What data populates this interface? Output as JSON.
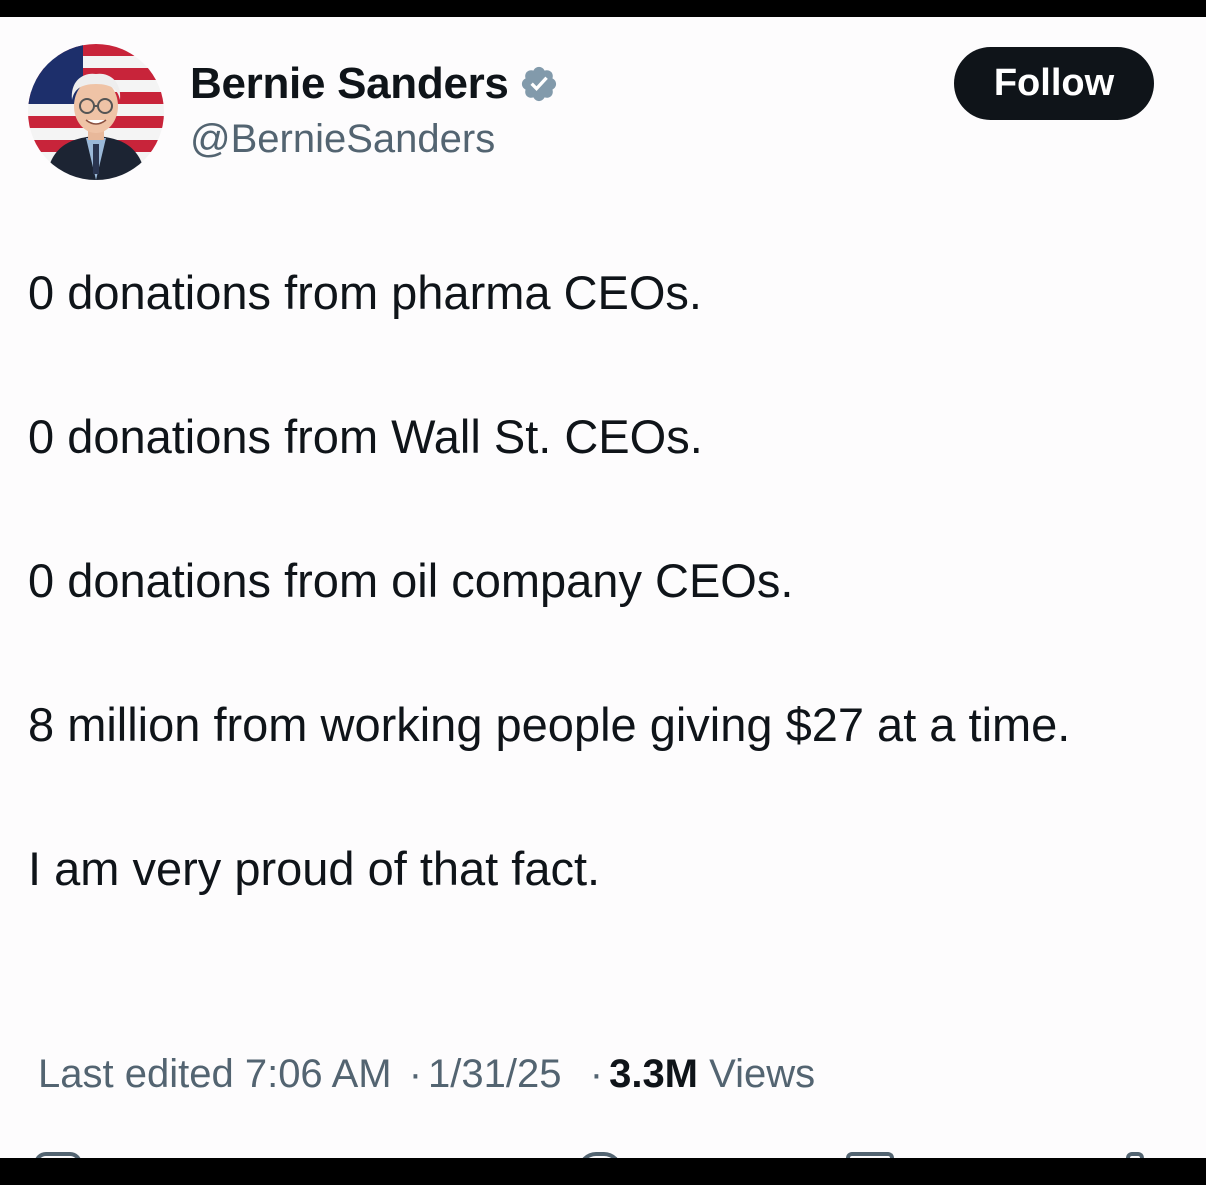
{
  "author": {
    "display_name": "Bernie Sanders",
    "handle": "@BernieSanders",
    "verified": true,
    "verified_color": "#829aab"
  },
  "follow_button": {
    "label": "Follow"
  },
  "tweet": {
    "lines": [
      "0 donations from pharma CEOs.",
      "0 donations from Wall St. CEOs.",
      "0 donations from oil company CEOs.",
      "8 million from working people giving $27 at a time.",
      "I am very proud of that fact."
    ]
  },
  "meta": {
    "edited_label": "Last edited",
    "time": "7:06 AM",
    "date": "1/31/25",
    "views_count": "3.3M",
    "views_label": "Views"
  },
  "icons": {
    "avatar": "profile-photo",
    "verified": "verified-badge-icon",
    "reply": "reply-icon",
    "like": "like-icon",
    "bookmark": "bookmark-icon",
    "share": "share-icon"
  },
  "colors": {
    "background": "#fdfcfd",
    "text": "#0f1419",
    "secondary_text": "#536471",
    "button": "#0f1419"
  }
}
